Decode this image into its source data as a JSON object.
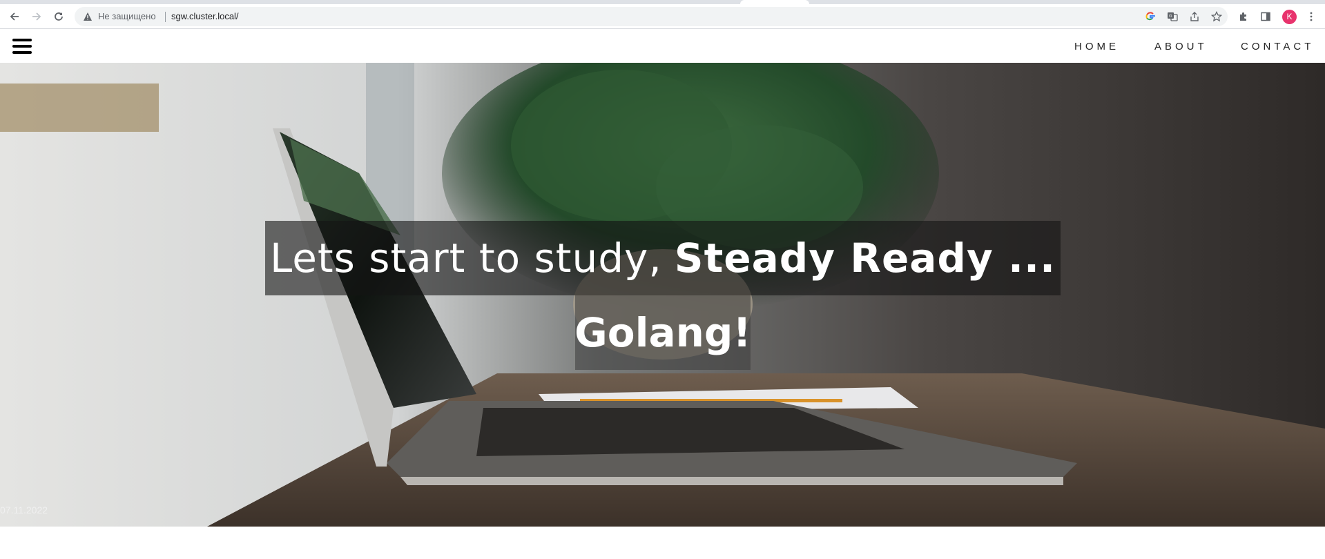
{
  "browser": {
    "security_label": "Не защищено",
    "url": "sgw.cluster.local/",
    "profile_initial": "K",
    "icons": [
      "back-icon",
      "forward-icon",
      "reload-icon",
      "warning-icon",
      "google-icon",
      "translate-icon",
      "share-icon",
      "star-icon",
      "extensions-icon",
      "side-panel-icon",
      "menu-icon"
    ]
  },
  "site": {
    "nav": {
      "home": "HOME",
      "about": "ABOUT",
      "contact": "CONTACT"
    },
    "hero": {
      "line1_regular": "Lets start to study,",
      "line1_bold": "Steady Ready ...",
      "line2_bold": "Golang!",
      "date": "07.11.2022"
    }
  },
  "colors": {
    "avatar": "#e8336d",
    "hero_text": "#ffffff",
    "nav_text": "#222222"
  }
}
